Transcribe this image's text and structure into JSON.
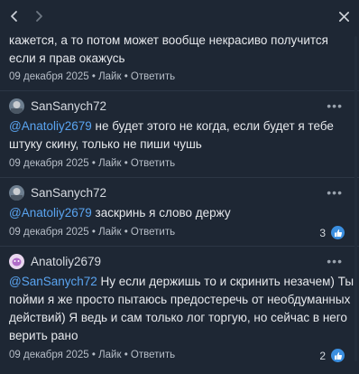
{
  "nav": {
    "back_icon": "chevron-left-icon",
    "forward_icon": "chevron-right-icon",
    "close_icon": "close-icon"
  },
  "colors": {
    "background": "#1e2734",
    "mention": "#5aa4f0",
    "like": "#3b8fe0"
  },
  "comments": [
    {
      "lines": [
        "кажется, а то потом может вообще некрасиво получится",
        "если я прав окажусь"
      ],
      "date": "09 декабря 2025",
      "like": "Лайк",
      "reply": "Ответить"
    },
    {
      "author": "SanSanych72",
      "mention": "@Anatoliy2679",
      "line1_rest": " не будет этого не когда, если будет я тебе",
      "line2": "штуку скину, только не пиши чушь",
      "date": "09 декабря 2025",
      "like": "Лайк",
      "reply": "Ответить"
    },
    {
      "author": "SanSanych72",
      "mention": "@Anatoliy2679",
      "line1_rest": " заскринь я слово держу",
      "date": "09 декабря 2025",
      "like": "Лайк",
      "reply": "Ответить",
      "likes_count": "3"
    },
    {
      "author": "Anatoliy2679",
      "mention": "@SanSanych72",
      "line1_rest": " Ну если держишь то и скринить незачем) Ты",
      "line2": "пойми я же просто пытаюсь предостеречь от необдуманных",
      "line3": "действий) Я ведь и сам только лог торгую, но сейчас в него",
      "line4": "верить рано",
      "date": "09 декабря 2025",
      "like": "Лайк",
      "reply": "Ответить",
      "likes_count": "2"
    }
  ],
  "separator": "•"
}
